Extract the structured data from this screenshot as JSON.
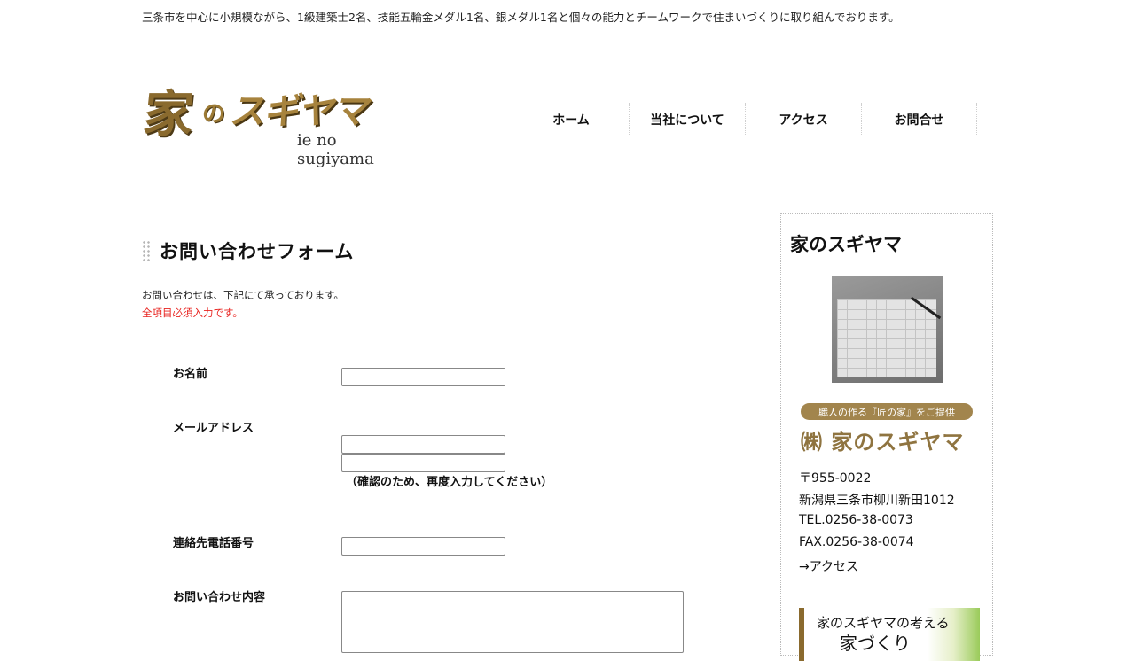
{
  "header": {
    "tagline": "三条市を中心に小規模ながら、1級建築士2名、技能五輪金メダル1名、銀メダル1名と個々の能力とチームワークで住まいづくりに取り組んでおります。",
    "logo": {
      "kanji": "家",
      "no": "の",
      "katakana": "スギヤマ",
      "roman": "ie no sugiyama"
    }
  },
  "nav": {
    "items": [
      {
        "label": "ホーム"
      },
      {
        "label": "当社について"
      },
      {
        "label": "アクセス"
      },
      {
        "label": "お問合せ"
      }
    ]
  },
  "main": {
    "title": "お問い合わせフォーム",
    "intro": "お問い合わせは、下記にて承っております。",
    "required_note": "全項目必須入力です。",
    "form": {
      "name_label": "お名前",
      "email_label": "メールアドレス",
      "email_confirm_note": "（確認のため、再度入力してください）",
      "phone_label": "連絡先電話番号",
      "inquiry_label": "お問い合わせ内容"
    }
  },
  "sidebar": {
    "title": "家のスギヤマ",
    "catch": "職人の作る『匠の家』をご提供",
    "company": "㈱ 家のスギヤマ",
    "postal": "〒955-0022",
    "address": "新潟県三条市柳川新田1012",
    "tel": "TEL.0256-38-0073",
    "fax": "FAX.0256-38-0074",
    "access_link": "→アクセス",
    "banner_line1": "家のスギヤマの考える",
    "banner_line2": "家づくり"
  },
  "colors": {
    "accent_gold": "#a2854d",
    "required_red": "#e8231f",
    "banner_bar": "#8a6a2e"
  }
}
